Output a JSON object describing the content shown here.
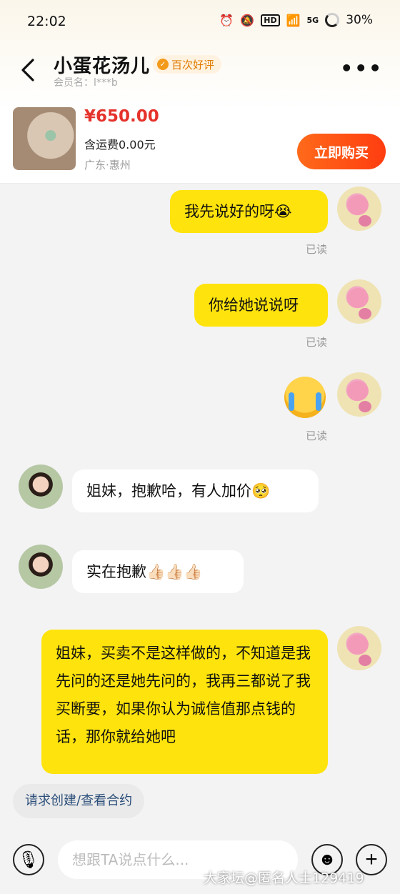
{
  "status_bar": {
    "time": "22:02",
    "hd": "HD",
    "signal": "5G",
    "battery": "30%"
  },
  "header": {
    "nickname": "小蛋花汤儿",
    "badge": "百次好评",
    "member_label": "会员名：l***b"
  },
  "product": {
    "price": "¥650.00",
    "shipping": "含运费0.00元",
    "location": "广东·惠州",
    "buy_label": "立即购买"
  },
  "messages": [
    {
      "from": "me",
      "text": "我先说好的呀😭",
      "status": "已读"
    },
    {
      "from": "me",
      "text": "你给她说说呀",
      "status": "已读"
    },
    {
      "from": "me",
      "emoji": "crying-face",
      "status": "已读"
    },
    {
      "from": "them",
      "text": "姐妹，抱歉哈，有人加价🥺"
    },
    {
      "from": "them",
      "text": "实在抱歉👍🏻👍🏻👍🏻"
    },
    {
      "from": "me",
      "text": "姐妹，买卖不是这样做的，不知道是我先问的还是她先问的，我再三都说了我买断要，如果你认为诚信值那点钱的话，那你就给她吧"
    }
  ],
  "contract_chip": "请求创建/查看合约",
  "input": {
    "placeholder": "想跟TA说点什么..."
  },
  "watermark": "大家坛@匿名人士129419"
}
